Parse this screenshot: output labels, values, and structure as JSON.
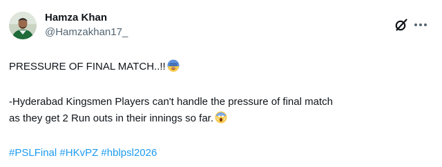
{
  "tweet": {
    "author": {
      "display_name": "Hamza Khan",
      "handle": "@Hamzakhan17_",
      "avatar_icon": "user-avatar"
    },
    "header_icons": [
      "grok-icon",
      "more-options-icon"
    ],
    "line1": "PRESSURE OF FINAL MATCH..!!",
    "line1_emoji": "anxious-face-emoji",
    "line2": "-Hyderabad Kingsmen Players can't handle the pressure of final match",
    "line3": "as they get 2 Run outs in their innings so far.",
    "line3_emoji": "screaming-face-emoji",
    "hashtags": [
      "#PSLFinal",
      "#HKvPZ",
      "#hblpsl2026"
    ]
  },
  "colors": {
    "text": "#0f1419",
    "secondary": "#536471",
    "link": "#1d9bf0",
    "background": "#ffffff"
  }
}
